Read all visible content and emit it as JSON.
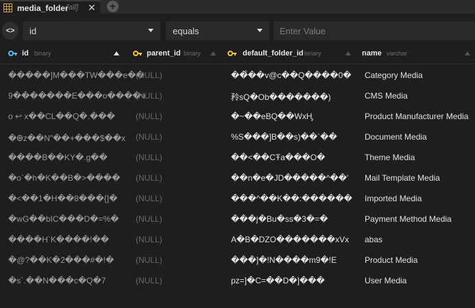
{
  "tab": {
    "title": "media_folder",
    "subtitle": "[all]",
    "close_glyph": "✕",
    "new_tab_glyph": "+"
  },
  "filter": {
    "toggle_label": "<>",
    "column": "id",
    "operator": "equals",
    "value_placeholder": "Enter Value"
  },
  "colors": {
    "id_key": "#4fc3f7",
    "fk_key": "#f5c542"
  },
  "columns": [
    {
      "name": "id",
      "type": "binary",
      "key": "primary-key-icon"
    },
    {
      "name": "parent_id",
      "type": "binary",
      "key": "foreign-key-icon"
    },
    {
      "name": "default_folder_id",
      "type": "binary",
      "key": "foreign-key-icon"
    },
    {
      "name": "name",
      "type": "varchar",
      "key": ""
    }
  ],
  "rows": [
    {
      "id": "�����]M���TW���e��",
      "parent_id": "(NULL)",
      "default_folder_id": "��̐��v@c��Q����0�",
      "name": "Category Media"
    },
    {
      "id": "9�������E���o����ч",
      "parent_id": "(NULL)",
      "default_folder_id": "矝sQ�Ob�������)",
      "name": "CMS Media"
    },
    {
      "id": "o ↩ x��CL��Q�.���",
      "parent_id": "(NULL)",
      "default_folder_id": "�~��eBQ��WxH̡",
      "name": "Product Manufacturer Media"
    },
    {
      "id": "�Ꚛz��N\"��+���$��x",
      "parent_id": "(NULL)",
      "default_folder_id": "%S���]B��s)��`��",
      "name": "Document Media"
    },
    {
      "id": "����B��KY�.g��",
      "parent_id": "(NULL)",
      "default_folder_id": "��<��CŦa���O�",
      "name": "Theme Media"
    },
    {
      "id": "�o`�h�K��B�>����",
      "parent_id": "(NULL)",
      "default_folder_id": "��n�e�JD�����^��'",
      "name": "Mail Template Media"
    },
    {
      "id": "�<��1�H��8���{]�",
      "parent_id": "(NULL)",
      "default_folder_id": "���^��K��:������",
      "name": "Imported Media"
    },
    {
      "id": "�wG��bIC���D�=%�",
      "parent_id": "(NULL)",
      "default_folder_id": "���j�Bu�ss�3�=�",
      "name": "Payment Method Media"
    },
    {
      "id": "����H`K����!��",
      "parent_id": "(NULL)",
      "default_folder_id": "A�B�DZO�������xVx",
      "name": "abas"
    },
    {
      "id": "�@?��K�2���#�!�",
      "parent_id": "(NULL)",
      "default_folder_id": "���]�!N����m9�!E",
      "name": "Product Media"
    },
    {
      "id": "�s`.��N���c�Q�7",
      "parent_id": "(NULL)",
      "default_folder_id": "pz=]�C=��D�]���",
      "name": "User Media"
    }
  ]
}
